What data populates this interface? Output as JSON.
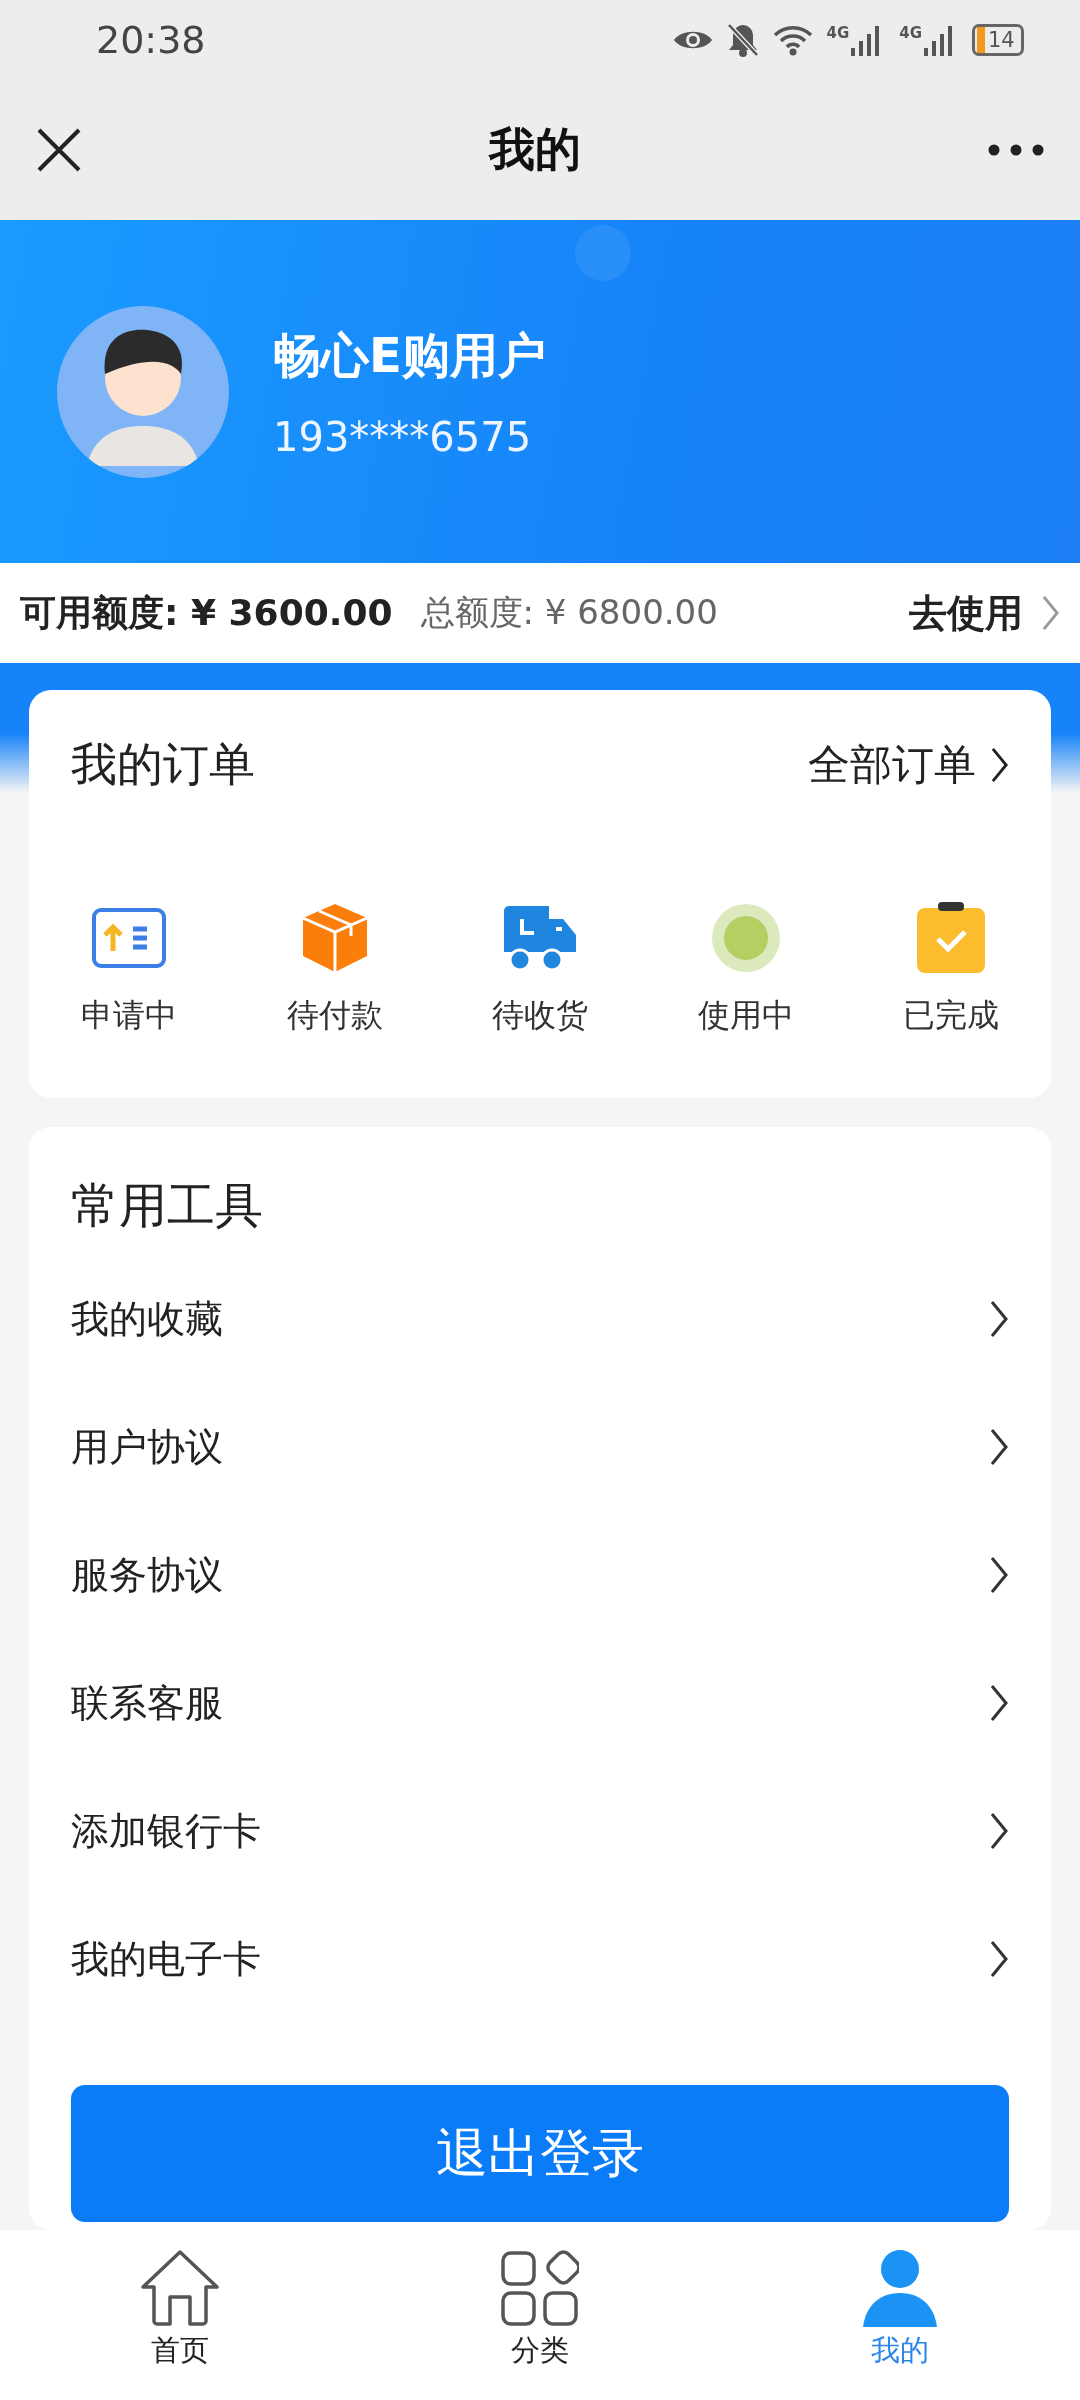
{
  "status_bar": {
    "time": "20:38",
    "networks": [
      "4G",
      "4G"
    ],
    "battery": "14"
  },
  "nav": {
    "title": "我的"
  },
  "profile": {
    "name": "畅心E购用户",
    "phone": "193****6575"
  },
  "credit": {
    "available_label": "可用额度:",
    "available": "¥ 3600.00",
    "total_label": "总额度:",
    "total": "¥ 6800.00",
    "action": "去使用"
  },
  "orders": {
    "title": "我的订单",
    "all": "全部订单",
    "statuses": [
      {
        "kind": "applying",
        "label": "申请中"
      },
      {
        "kind": "unpaid",
        "label": "待付款"
      },
      {
        "kind": "shipping",
        "label": "待收货"
      },
      {
        "kind": "in_use",
        "label": "使用中"
      },
      {
        "kind": "done",
        "label": "已完成"
      }
    ]
  },
  "tools": {
    "title": "常用工具",
    "items": [
      "我的收藏",
      "用户协议",
      "服务协议",
      "联系客服",
      "添加银行卡",
      "我的电子卡"
    ]
  },
  "logout": "退出登录",
  "tabs": [
    {
      "kind": "home",
      "label": "首页",
      "selected": false
    },
    {
      "kind": "category",
      "label": "分类",
      "selected": false
    },
    {
      "kind": "me",
      "label": "我的",
      "selected": true
    }
  ]
}
